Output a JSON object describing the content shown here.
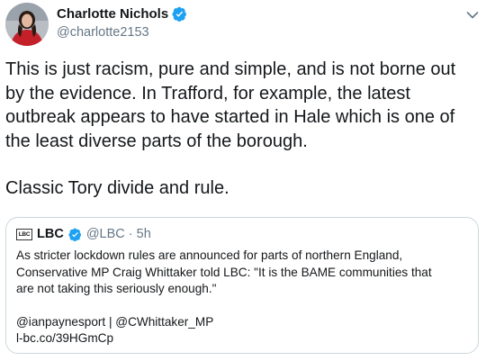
{
  "author": {
    "name": "Charlotte Nichols",
    "handle": "@charlotte2153",
    "avatar_icon": "avatar-photo",
    "verified": true
  },
  "tweet": {
    "paragraph_1": "This is just racism, pure and simple, and is not borne out\nby the evidence. In Trafford, for example, the latest\noutbreak appears to have started in Hale which is one of\nthe least diverse parts of the borough.",
    "paragraph_2": "Classic Tory divide and rule."
  },
  "quoted_tweet": {
    "logo_text": "LBC",
    "name": "LBC",
    "verified": true,
    "handle_time": "@LBC · 5h",
    "paragraph_1": "As stricter lockdown rules are announced for parts of northern England,\nConservative MP Craig Whittaker told LBC: \"It is the BAME communities that\nare not taking this seriously enough.\"",
    "paragraph_2": "@ianpaynesport | @CWhittaker_MP\nl-bc.co/39HGmCp"
  },
  "colors": {
    "text": "#14171a",
    "secondary": "#657786",
    "verified_blue": "#1da1f2",
    "border": "#ccd6dd"
  },
  "icons": {
    "menu": "chevron-down-icon",
    "verified": "verified-badge-icon"
  }
}
